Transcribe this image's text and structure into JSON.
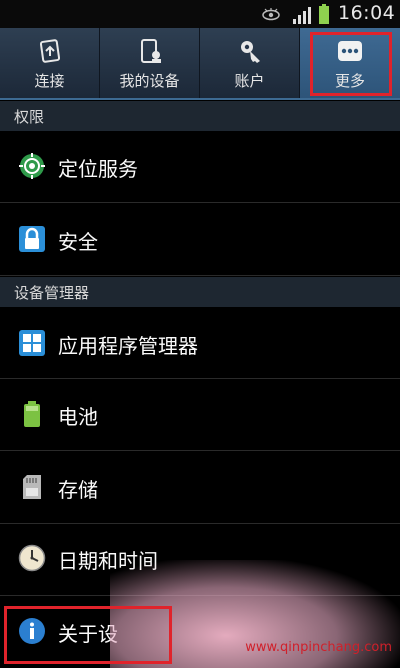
{
  "status_bar": {
    "time": "16:04"
  },
  "tabs": [
    {
      "label": "连接",
      "icon": "connections-icon"
    },
    {
      "label": "我的设备",
      "icon": "my-device-icon"
    },
    {
      "label": "账户",
      "icon": "accounts-icon"
    },
    {
      "label": "更多",
      "icon": "more-icon",
      "active": true
    }
  ],
  "sections": [
    {
      "header": "权限",
      "items": [
        {
          "label": "定位服务",
          "icon": "location-icon"
        },
        {
          "label": "安全",
          "icon": "lock-icon"
        }
      ]
    },
    {
      "header": "设备管理器",
      "items": [
        {
          "label": "应用程序管理器",
          "icon": "app-grid-icon"
        },
        {
          "label": "电池",
          "icon": "battery-icon"
        },
        {
          "label": "存储",
          "icon": "sd-card-icon"
        },
        {
          "label": "日期和时间",
          "icon": "clock-icon"
        },
        {
          "label": "关于设",
          "icon": "info-icon"
        }
      ]
    }
  ],
  "watermark": "www.qinpinchang.com",
  "colors": {
    "highlight": "#e0232b",
    "tab_active": "#3f6a93",
    "section_bg": "#1e2731",
    "background": "#000000"
  }
}
